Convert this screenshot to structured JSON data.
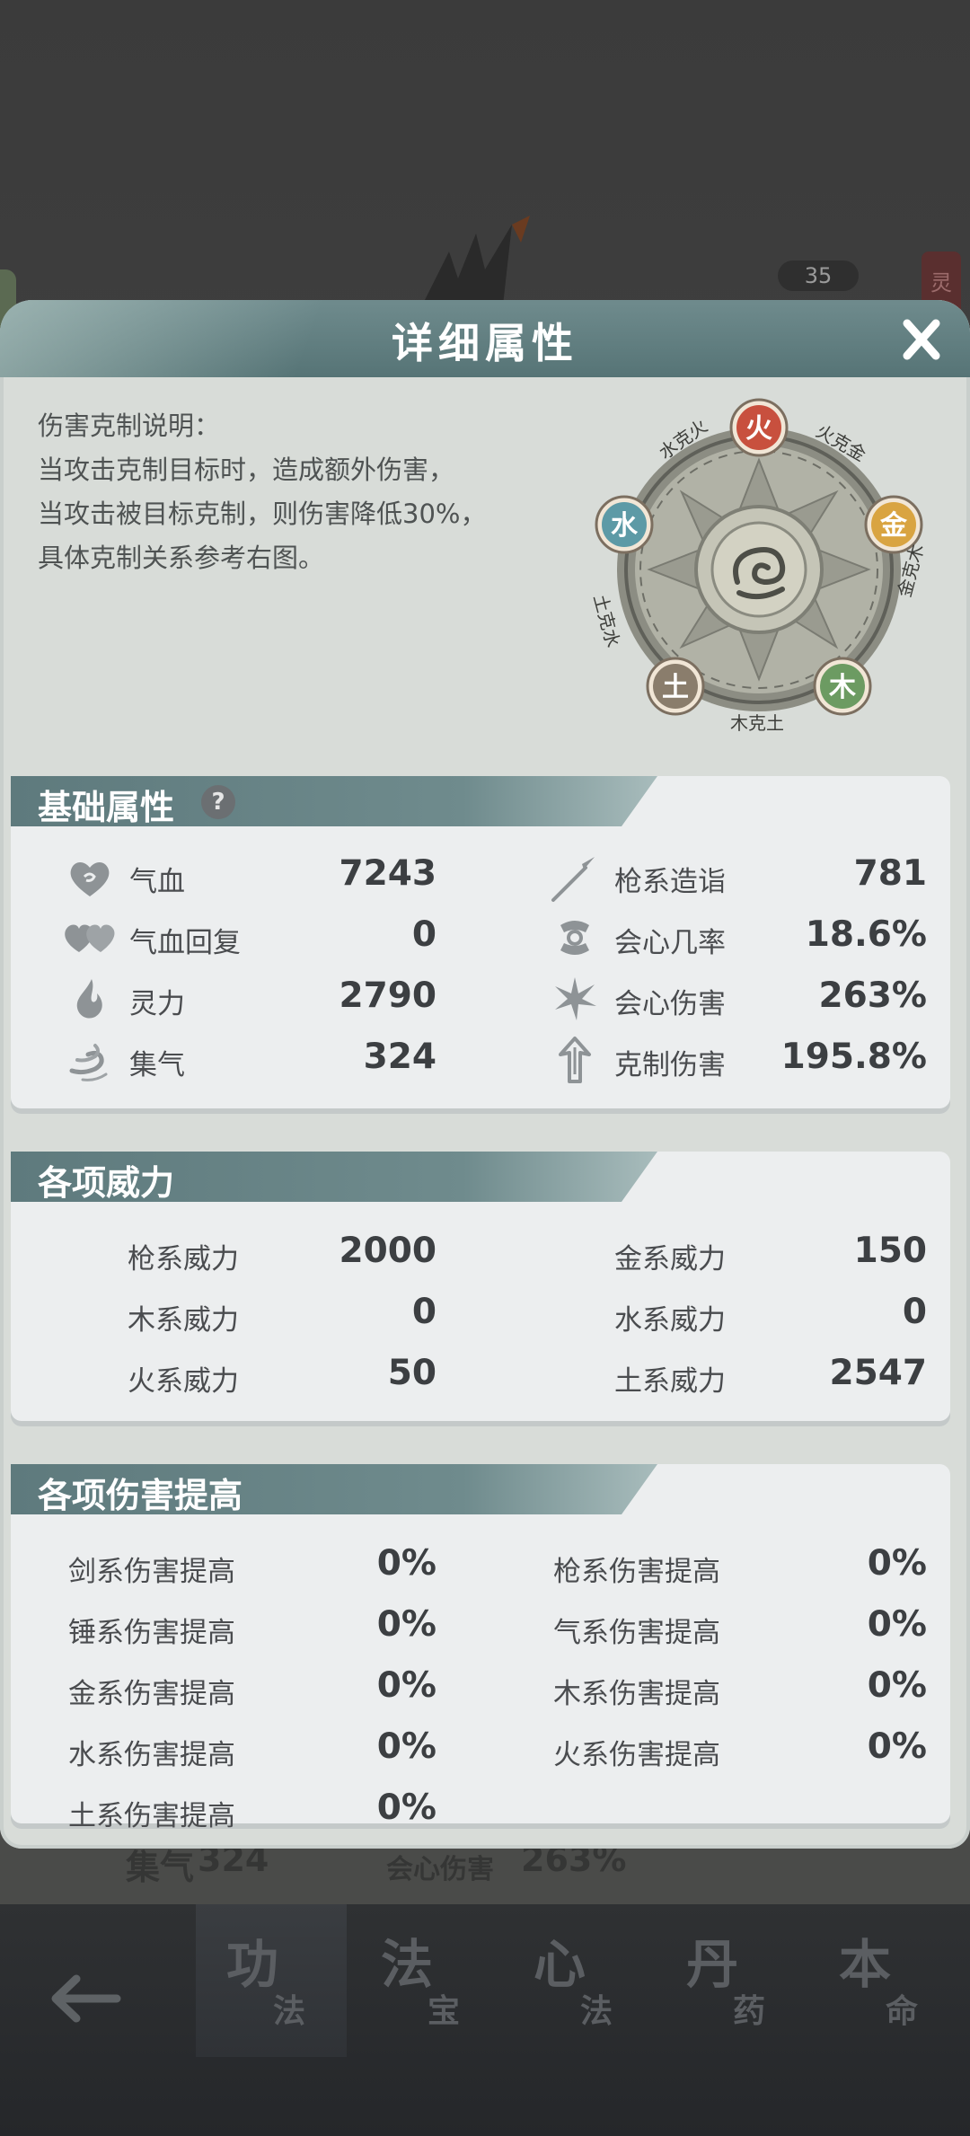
{
  "background": {
    "badge_number": "35",
    "side_tag": "灵",
    "peek_label": "集气",
    "peek_value": "324",
    "peek_label2": "会心伤害",
    "peek_value2": "263%"
  },
  "panel": {
    "title": "详细属性",
    "close_label": "X"
  },
  "explanation": {
    "lines": [
      "伤害克制说明：",
      "当攻击克制目标时，造成额外伤害，",
      "当攻击被目标克制，则伤害降低30%，",
      "具体克制关系参考右图。"
    ]
  },
  "element_wheel": {
    "nodes": {
      "fire": "火",
      "metal": "金",
      "wood": "木",
      "earth": "土",
      "water": "水"
    },
    "relations": {
      "water_fire": "水克火",
      "fire_metal": "火克金",
      "metal_wood": "金克木",
      "wood_earth": "木克土",
      "earth_water": "土克水"
    },
    "colors": {
      "fire": "#c8503e",
      "metal": "#d9a441",
      "wood": "#6c9b62",
      "earth": "#8a7d6c",
      "water": "#5d9aa6"
    }
  },
  "basic_attributes": {
    "title": "基础属性",
    "help_icon": "?",
    "left": [
      {
        "icon": "heart-icon",
        "label": "气血",
        "value": "7243"
      },
      {
        "icon": "double-heart-icon",
        "label": "气血回复",
        "value": "0"
      },
      {
        "icon": "flame-drop-icon",
        "label": "灵力",
        "value": "2790"
      },
      {
        "icon": "swirl-icon",
        "label": "集气",
        "value": "324"
      }
    ],
    "right": [
      {
        "icon": "spear-icon",
        "label": "枪系造诣",
        "value": "781"
      },
      {
        "icon": "crit-rate-icon",
        "label": "会心几率",
        "value": "18.6%"
      },
      {
        "icon": "burst-icon",
        "label": "会心伤害",
        "value": "263%"
      },
      {
        "icon": "arrow-up-icon",
        "label": "克制伤害",
        "value": "195.8%"
      }
    ]
  },
  "power": {
    "title": "各项威力",
    "left": [
      {
        "label": "枪系威力",
        "value": "2000"
      },
      {
        "label": "木系威力",
        "value": "0"
      },
      {
        "label": "火系威力",
        "value": "50"
      }
    ],
    "right": [
      {
        "label": "金系威力",
        "value": "150"
      },
      {
        "label": "水系威力",
        "value": "0"
      },
      {
        "label": "土系威力",
        "value": "2547"
      }
    ]
  },
  "damage_boost": {
    "title": "各项伤害提高",
    "left": [
      {
        "label": "剑系伤害提高",
        "value": "0%"
      },
      {
        "label": "锤系伤害提高",
        "value": "0%"
      },
      {
        "label": "金系伤害提高",
        "value": "0%"
      },
      {
        "label": "水系伤害提高",
        "value": "0%"
      },
      {
        "label": "土系伤害提高",
        "value": "0%"
      }
    ],
    "right": [
      {
        "label": "枪系伤害提高",
        "value": "0%"
      },
      {
        "label": "气系伤害提高",
        "value": "0%"
      },
      {
        "label": "木系伤害提高",
        "value": "0%"
      },
      {
        "label": "火系伤害提高",
        "value": "0%"
      }
    ]
  },
  "bottom_nav": {
    "tabs": [
      {
        "big": "功",
        "small": "法"
      },
      {
        "big": "法",
        "small": "宝"
      },
      {
        "big": "心",
        "small": "法"
      },
      {
        "big": "丹",
        "small": "药"
      },
      {
        "big": "本",
        "small": "命"
      }
    ]
  }
}
